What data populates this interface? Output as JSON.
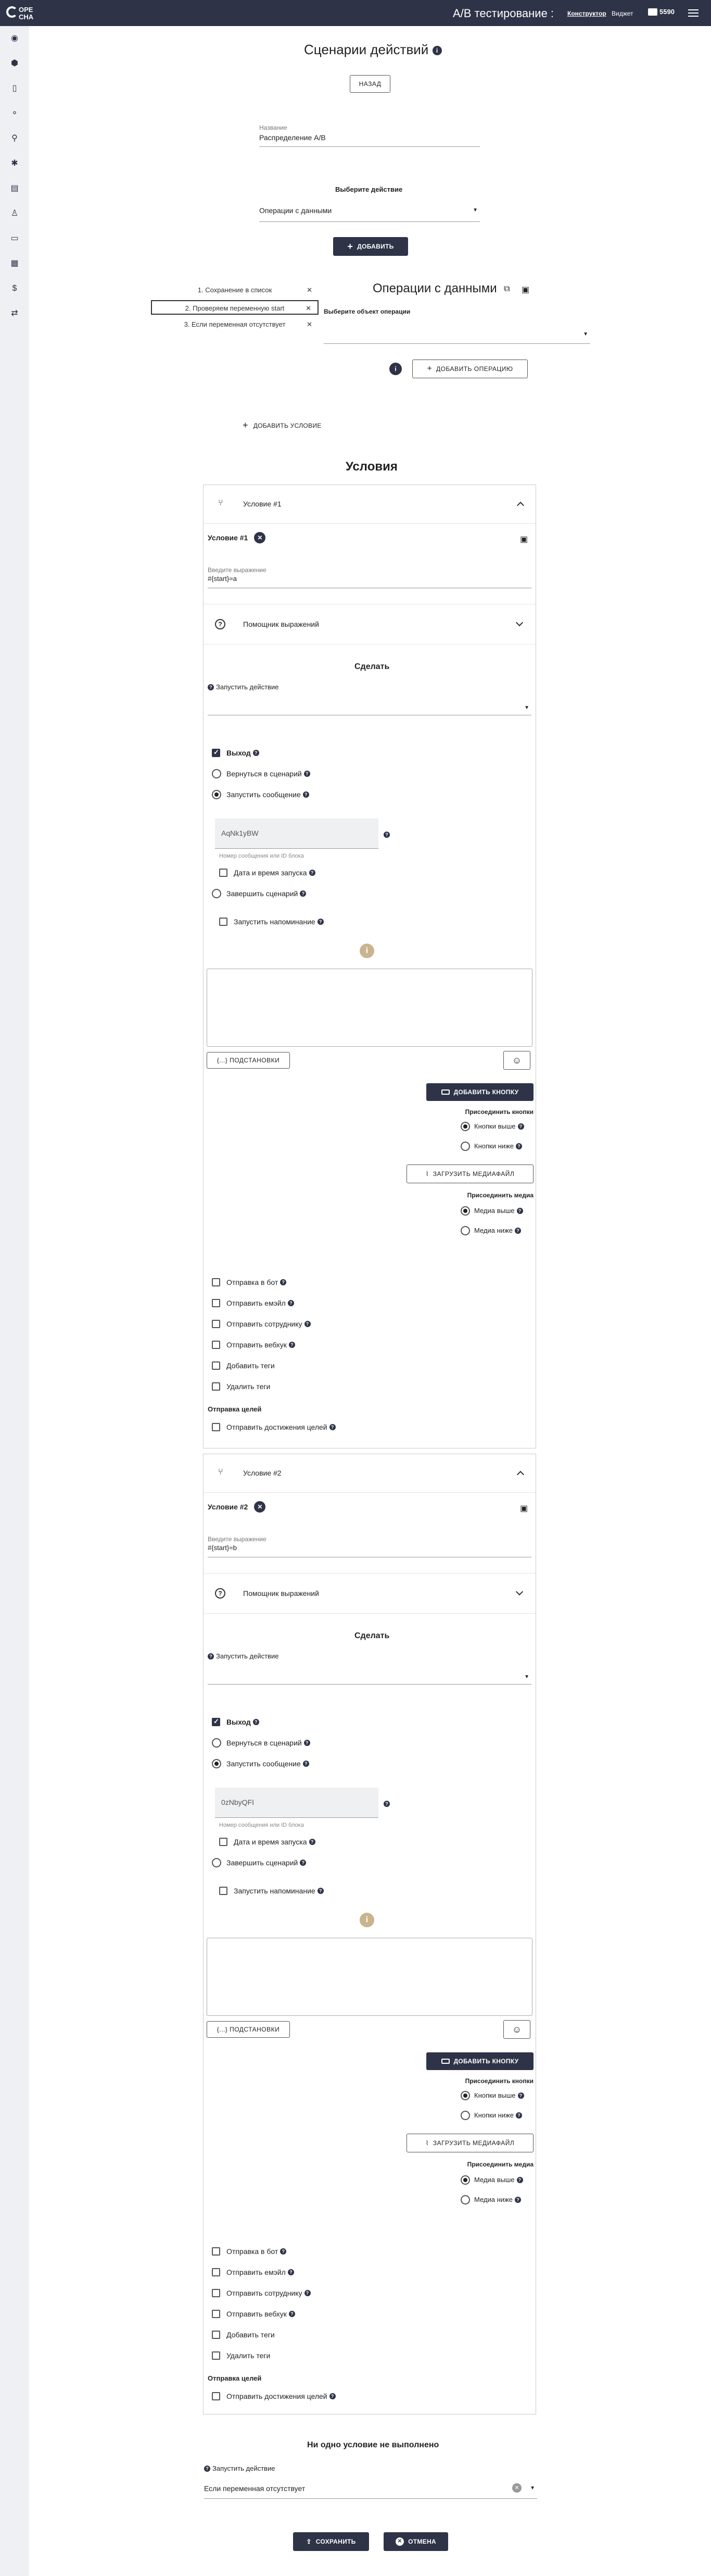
{
  "header": {
    "brand_line1": "OPE",
    "brand_line2": "CHA",
    "page_title": "А/В тестирование :",
    "nav_constructor": "Конструктор",
    "nav_widget": "Виджет",
    "balance": "5590"
  },
  "page": {
    "title": "Сценарии действий",
    "back_label": "НАЗАД"
  },
  "name_field": {
    "label": "Название",
    "value": "Распределение А/В"
  },
  "action": {
    "heading": "Выберите действие",
    "select_value": "Операции с данными",
    "add_label": "ДОБАВИТЬ"
  },
  "steps": [
    {
      "label": "1. Сохранение в список"
    },
    {
      "label": "2. Проверяем переменную start"
    },
    {
      "label": "3. Если переменная отсутствует"
    }
  ],
  "data_ops": {
    "title": "Операции с данными",
    "object_label": "Выберите объект операции",
    "add_op_label": "ДОБАВИТЬ ОПЕРАЦИЮ"
  },
  "add_condition_label": "ДОБАВИТЬ УСЛОВИЕ",
  "conditions_title": "Условия",
  "conditions": [
    {
      "header": "Условие #1",
      "chip": "Условие #1",
      "expr_label": "Введите выражение",
      "expr_value": "#{start}=a",
      "helper": "Помощник выражений",
      "do_title": "Сделать",
      "run_action": "Запустить действие",
      "exit": "Выход",
      "return_scenario": "Вернуться в сценарий",
      "run_message": "Запустить сообщение",
      "message_id": "AqNk1yBW",
      "message_hint": "Номер сообщения или ID блока",
      "start_time": "Дата и время запуска",
      "finish": "Завершить сценарий",
      "reminder": "Запустить напоминание",
      "subs_label": "{...} ПОДСТАНОВКИ",
      "add_button": "ДОБАВИТЬ КНОПКУ",
      "attach_buttons": "Присоединить кнопки",
      "buttons_above": "Кнопки выше",
      "buttons_below": "Кнопки ниже",
      "upload_media": "ЗАГРУЗИТЬ МЕДИАФАЙЛ",
      "attach_media": "Присоединить медиа",
      "media_above": "Медиа выше",
      "media_below": "Медиа ниже",
      "send_bot": "Отправка в бот",
      "send_email": "Отправить емэйл",
      "send_employee": "Отправить сотруднику",
      "send_webhook": "Отправить вебхук",
      "add_tags": "Добавить теги",
      "remove_tags": "Удалить теги",
      "goals_title": "Отправка целей",
      "send_goal": "Отправить достижения целей"
    },
    {
      "header": "Условие #2",
      "chip": "Условие #2",
      "expr_label": "Введите выражение",
      "expr_value": "#{start}=b",
      "helper": "Помощник выражений",
      "do_title": "Сделать",
      "run_action": "Запустить действие",
      "exit": "Выход",
      "return_scenario": "Вернуться в сценарий",
      "run_message": "Запустить сообщение",
      "message_id": "0zNbyQFI",
      "message_hint": "Номер сообщения или ID блока",
      "start_time": "Дата и время запуска",
      "finish": "Завершить сценарий",
      "reminder": "Запустить напоминание",
      "subs_label": "{...} ПОДСТАНОВКИ",
      "add_button": "ДОБАВИТЬ КНОПКУ",
      "attach_buttons": "Присоединить кнопки",
      "buttons_above": "Кнопки выше",
      "buttons_below": "Кнопки ниже",
      "upload_media": "ЗАГРУЗИТЬ МЕДИАФАЙЛ",
      "attach_media": "Присоединить медиа",
      "media_above": "Медиа выше",
      "media_below": "Медиа ниже",
      "send_bot": "Отправка в бот",
      "send_email": "Отправить емэйл",
      "send_employee": "Отправить сотруднику",
      "send_webhook": "Отправить вебхук",
      "add_tags": "Добавить теги",
      "remove_tags": "Удалить теги",
      "goals_title": "Отправка целей",
      "send_goal": "Отправить достижения целей"
    }
  ],
  "fallback": {
    "title": "Ни одно условие не выполнено",
    "run_action": "Запустить действие",
    "select_value": "Если переменная отсутствует"
  },
  "footer": {
    "save_label": "СОХРАНИТЬ",
    "cancel_label": "ОТМЕНА"
  },
  "colors": {
    "dark": "#2e3347",
    "gold": "#c9b48f"
  }
}
